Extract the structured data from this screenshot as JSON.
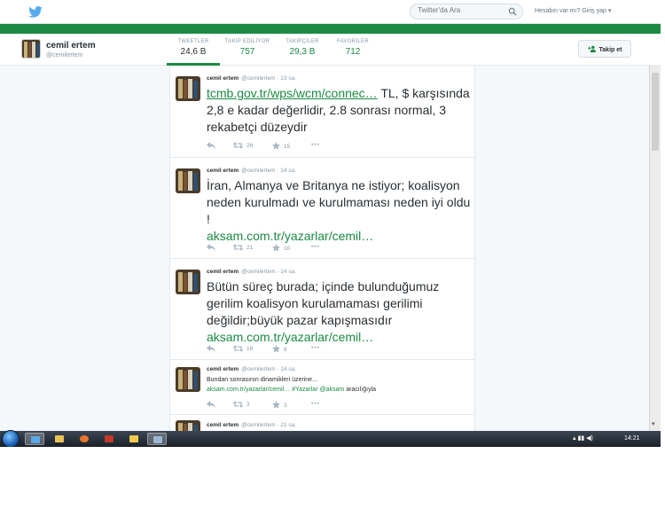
{
  "topbar": {
    "search_placeholder": "Twitter'da Ara",
    "login_text": "Hesabın var mı? Giriş yap ▾"
  },
  "profile": {
    "name": "cemil ertem",
    "handle": "@cemilertem",
    "stats": [
      {
        "label": "TWEETLER",
        "value": "24,6 B"
      },
      {
        "label": "TAKİP EDİLİYOR",
        "value": "757"
      },
      {
        "label": "TAKİPÇİLER",
        "value": "29,3 B"
      },
      {
        "label": "FAVORİLER",
        "value": "712"
      }
    ],
    "follow_label": "Takip et"
  },
  "tweets": [
    {
      "name": "cemil ertem",
      "meta": "@cemilertem · 13 sa.",
      "link": "tcmb.gov.tr/wps/wcm/connec…",
      "text": " TL, $ karşısında 2,8 e kadar değerlidir, 2.8 sonrası normal, 3 rekabetçi düzeydir",
      "retweets": "26",
      "favorites": "15"
    },
    {
      "name": "cemil ertem",
      "meta": "@cemilertem · 14 sa.",
      "text": "İran, Almanya ve Britanya ne istiyor; koalisyon neden kurulmadı ve kurulmaması neden iyi oldu !",
      "link": "aksam.com.tr/yazarlar/cemil…",
      "retweets": "21",
      "favorites": "10"
    },
    {
      "name": "cemil ertem",
      "meta": "@cemilertem · 14 sa.",
      "text": "Bütün süreç burada; içinde bulunduğumuz gerilim koalisyon kurulamaması gerilimi değildir;büyük pazar kapışmasıdır",
      "link": "aksam.com.tr/yazarlar/cemil…",
      "retweets": "16",
      "favorites": "8"
    },
    {
      "name": "cemil ertem",
      "meta": "@cemilertem · 14 sa.",
      "text": "Bundan sonrasının dinamikleri üzerine...",
      "link": "aksam.com.tr/yazarlar/cemil…",
      "via_hashtag": "#Yazarlar",
      "via_mention": "@aksam",
      "via_suffix": "aracılığıyla",
      "retweets": "3",
      "favorites": "3"
    },
    {
      "name": "cemil ertem",
      "meta": "@cemilertem · 21 sa."
    }
  ],
  "more_icon_text": "•••",
  "taskbar": {
    "tray": "▴ ▮▮ ◀)",
    "clock": "14:21"
  },
  "colors": {
    "accent_green": "#1c8a43",
    "twitter_blue": "#55acee"
  }
}
